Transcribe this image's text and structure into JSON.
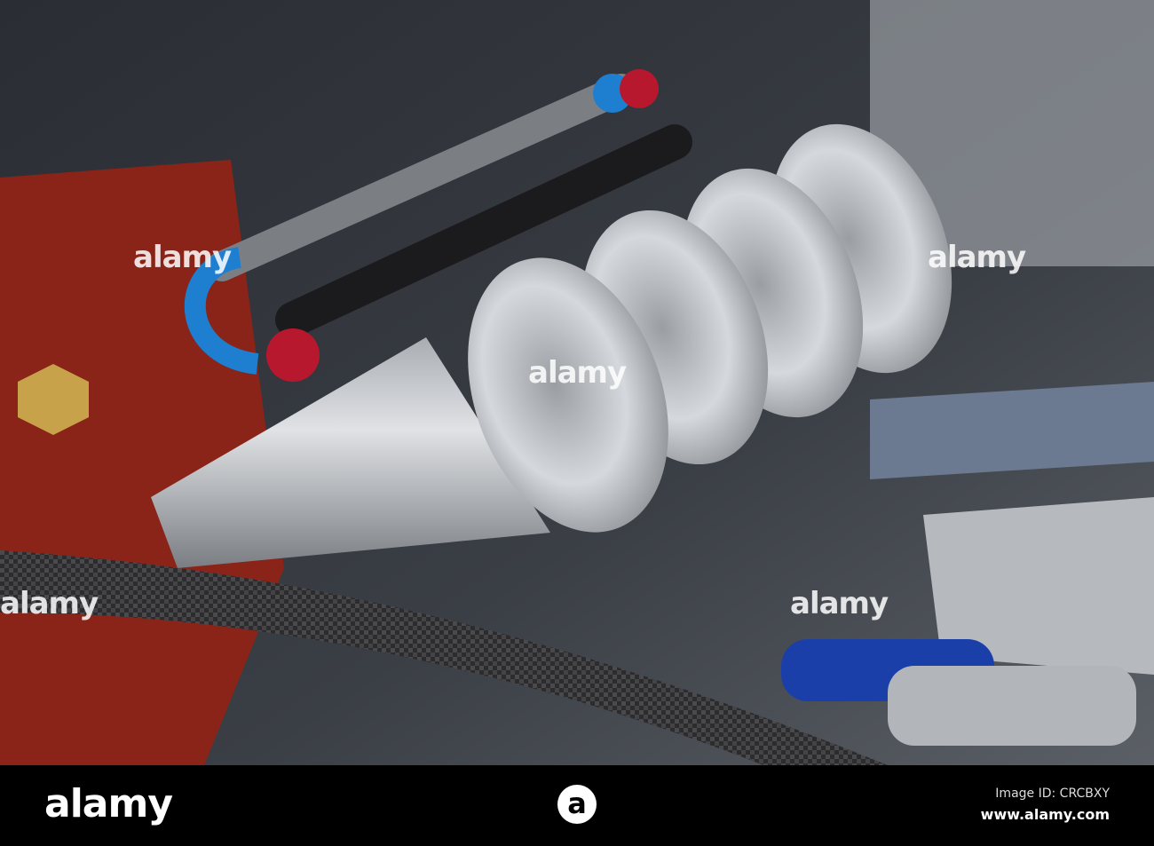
{
  "watermark": "alamy",
  "footer": {
    "logo": "alamy",
    "mark": "a",
    "image_id": "Image ID: CRCBXY",
    "url": "www.alamy.com"
  },
  "colors": {
    "silver": "#c8cbcf",
    "anodized_blue": "#1e7fd0",
    "anodized_red": "#b8182e",
    "engine_red": "#a82a1c"
  }
}
